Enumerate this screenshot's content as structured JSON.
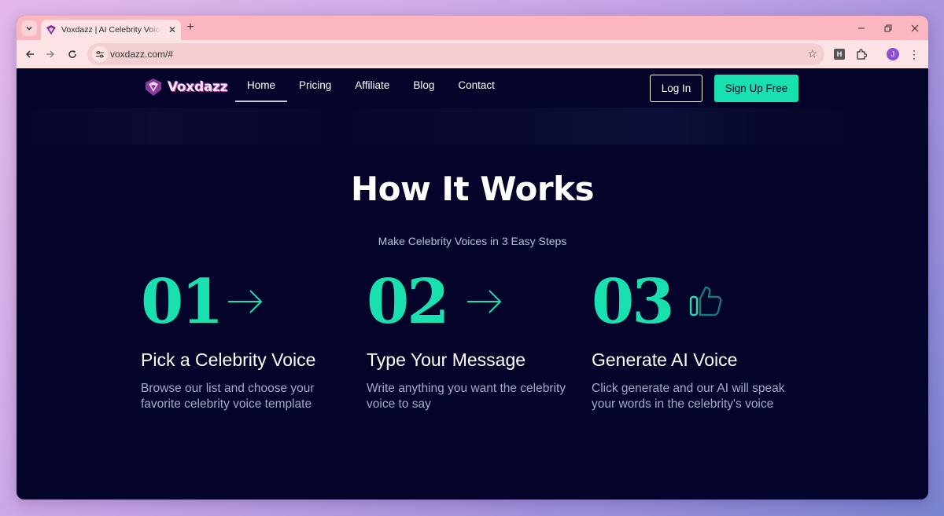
{
  "browser": {
    "tab_title": "Voxdazz | AI Celebrity Voice Generator",
    "url": "voxdazz.com/#",
    "profile_initial": "J",
    "extension_label": "H"
  },
  "nav": {
    "logo_text": "Voxdazz",
    "links": [
      "Home",
      "Pricing",
      "Affiliate",
      "Blog",
      "Contact"
    ],
    "active": "Home",
    "login": "Log In",
    "signup": "Sign Up Free"
  },
  "section": {
    "title": "How It Works",
    "subtitle": "Make Celebrity Voices in 3 Easy Steps"
  },
  "steps": [
    {
      "number": "01",
      "title": "Pick a Celebrity Voice",
      "description": "Browse our list and choose your favorite celebrity voice template",
      "icon": "arrow-right-icon"
    },
    {
      "number": "02",
      "title": "Type Your Message",
      "description": "Write anything you want the celebrity voice to say",
      "icon": "arrow-right-icon"
    },
    {
      "number": "03",
      "title": "Generate AI Voice",
      "description": "Click generate and our AI will speak your words in the celebrity's voice",
      "icon": "thumbs-up-icon"
    }
  ],
  "colors": {
    "accent": "#18e0ae",
    "page_bg": "#04032a",
    "tab_strip": "#fbb6c0",
    "toolbar": "#fde3e6"
  }
}
